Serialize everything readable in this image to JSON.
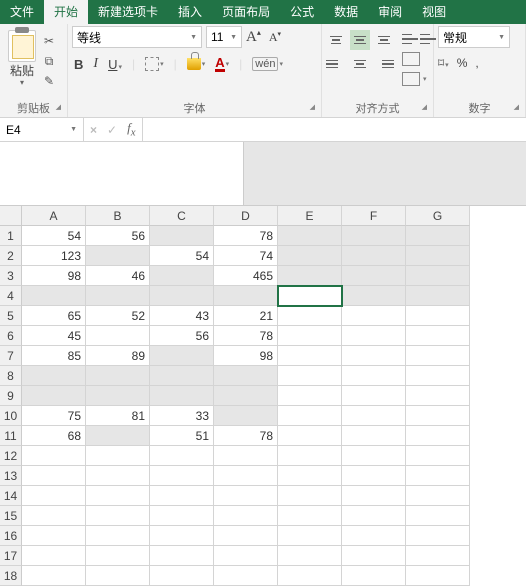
{
  "tabs": [
    "文件",
    "开始",
    "新建选项卡",
    "插入",
    "页面布局",
    "公式",
    "数据",
    "审阅",
    "视图"
  ],
  "active_tab_index": 1,
  "groups": {
    "clipboard": {
      "paste": "粘贴",
      "label": "剪贴板"
    },
    "font": {
      "name": "等线",
      "size": "11",
      "label": "字体"
    },
    "align": {
      "label": "对齐方式"
    },
    "number": {
      "format": "常规",
      "label": "数字"
    }
  },
  "namebox": "E4",
  "columns": [
    "A",
    "B",
    "C",
    "D",
    "E",
    "F",
    "G"
  ],
  "row_count": 18,
  "active_cell": [
    4,
    5
  ],
  "selected": [
    [
      1,
      3
    ],
    [
      1,
      5
    ],
    [
      1,
      6
    ],
    [
      1,
      7
    ],
    [
      2,
      2
    ],
    [
      2,
      5
    ],
    [
      2,
      6
    ],
    [
      2,
      7
    ],
    [
      3,
      3
    ],
    [
      3,
      5
    ],
    [
      3,
      6
    ],
    [
      3,
      7
    ],
    [
      4,
      1
    ],
    [
      4,
      2
    ],
    [
      4,
      3
    ],
    [
      4,
      4
    ],
    [
      4,
      5
    ],
    [
      4,
      6
    ],
    [
      4,
      7
    ],
    [
      7,
      3
    ],
    [
      8,
      1
    ],
    [
      8,
      2
    ],
    [
      8,
      3
    ],
    [
      8,
      4
    ],
    [
      9,
      1
    ],
    [
      9,
      2
    ],
    [
      9,
      3
    ],
    [
      9,
      4
    ],
    [
      10,
      4
    ],
    [
      11,
      2
    ]
  ],
  "cells": {
    "1": {
      "1": "54",
      "2": "56",
      "4": "78"
    },
    "2": {
      "1": "123",
      "3": "54",
      "4": "74"
    },
    "3": {
      "1": "98",
      "2": "46",
      "4": "465"
    },
    "5": {
      "1": "65",
      "2": "52",
      "3": "43",
      "4": "21"
    },
    "6": {
      "1": "45",
      "3": "56",
      "4": "78"
    },
    "7": {
      "1": "85",
      "2": "89",
      "4": "98"
    },
    "10": {
      "1": "75",
      "2": "81",
      "3": "33"
    },
    "11": {
      "1": "68",
      "3": "51",
      "4": "78"
    }
  },
  "chart_data": {
    "type": "table",
    "columns": [
      "A",
      "B",
      "C",
      "D"
    ],
    "rows": [
      [
        54,
        56,
        null,
        78
      ],
      [
        123,
        null,
        54,
        74
      ],
      [
        98,
        46,
        null,
        465
      ],
      [
        null,
        null,
        null,
        null
      ],
      [
        65,
        52,
        43,
        21
      ],
      [
        45,
        null,
        56,
        78
      ],
      [
        85,
        89,
        null,
        98
      ],
      [
        null,
        null,
        null,
        null
      ],
      [
        null,
        null,
        null,
        null
      ],
      [
        75,
        81,
        33,
        null
      ],
      [
        68,
        null,
        51,
        78
      ]
    ]
  }
}
